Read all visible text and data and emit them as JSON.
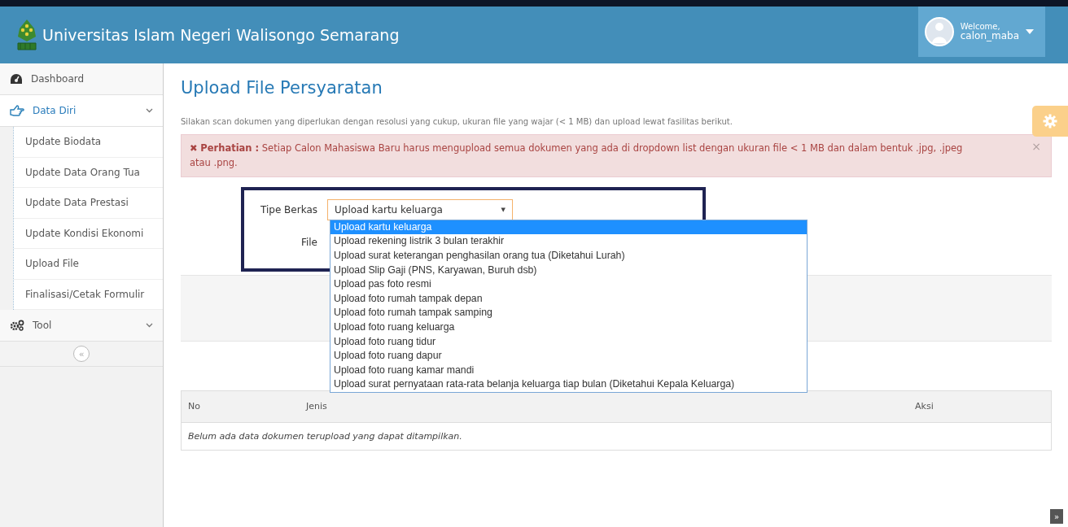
{
  "header": {
    "title": "Universitas Islam Negeri Walisongo Semarang",
    "welcome": "Welcome,",
    "user": "calon_maba"
  },
  "sidebar": {
    "items": [
      {
        "label": "Dashboard",
        "kind": "link",
        "selected": false
      },
      {
        "label": "Data Diri",
        "kind": "menu",
        "selected": true,
        "children": [
          {
            "label": "Update Biodata",
            "selected": false
          },
          {
            "label": "Update Data Orang Tua",
            "selected": false
          },
          {
            "label": "Update Data Prestasi",
            "selected": false
          },
          {
            "label": "Update Kondisi Ekonomi",
            "selected": false
          },
          {
            "label": "Upload File",
            "selected": false
          },
          {
            "label": "Finalisasi/Cetak Formulir",
            "selected": false
          }
        ]
      },
      {
        "label": "Tool",
        "kind": "menu",
        "selected": false
      }
    ],
    "collapse": "«"
  },
  "page": {
    "title": "Upload File Persyaratan",
    "description": "Silakan scan dokumen yang diperlukan dengan resolusi yang cukup, ukuran file yang wajar (< 1 MB) dan upload lewat fasilitas berikut.",
    "alert": {
      "mark": "✖",
      "text": "**Perhatian :** Setiap Calon Mahasiswa Baru harus mengupload semua dokumen yang ada di dropdown list dengan ukuran file < 1 MB dan dalam bentuk .jpg, .jpeg atau .png.",
      "close": "×"
    },
    "form": {
      "fields": [
        {
          "label": "Tipe Berkas",
          "kind": "select",
          "value": "Upload kartu keluarga",
          "caret": "▼"
        },
        {
          "label": "File",
          "kind": "file"
        }
      ],
      "options": [
        {
          "label": "Upload kartu keluarga",
          "selected": true
        },
        {
          "label": "Upload rekening listrik 3 bulan terakhir",
          "selected": false
        },
        {
          "label": "Upload surat keterangan penghasilan orang tua (Diketahui Lurah)",
          "selected": false
        },
        {
          "label": "Upload Slip Gaji (PNS, Karyawan, Buruh dsb)",
          "selected": false
        },
        {
          "label": "Upload pas foto resmi",
          "selected": false
        },
        {
          "label": "Upload foto rumah tampak depan",
          "selected": false
        },
        {
          "label": "Upload foto rumah tampak samping",
          "selected": false
        },
        {
          "label": "Upload foto ruang keluarga",
          "selected": false
        },
        {
          "label": "Upload foto ruang tidur",
          "selected": false
        },
        {
          "label": "Upload foto ruang dapur",
          "selected": false
        },
        {
          "label": "Upload foto ruang kamar mandi",
          "selected": false
        },
        {
          "label": "Upload surat pernyataan rata-rata belanja keluarga tiap bulan (Diketahui Kepala Keluarga)",
          "selected": false
        }
      ]
    },
    "table": {
      "columns": [
        "No",
        "Jenis",
        "Aksi"
      ],
      "empty_message": "Belum ada data dokumen terupload yang dapat ditampilkan."
    }
  },
  "scroll_top": "»"
}
